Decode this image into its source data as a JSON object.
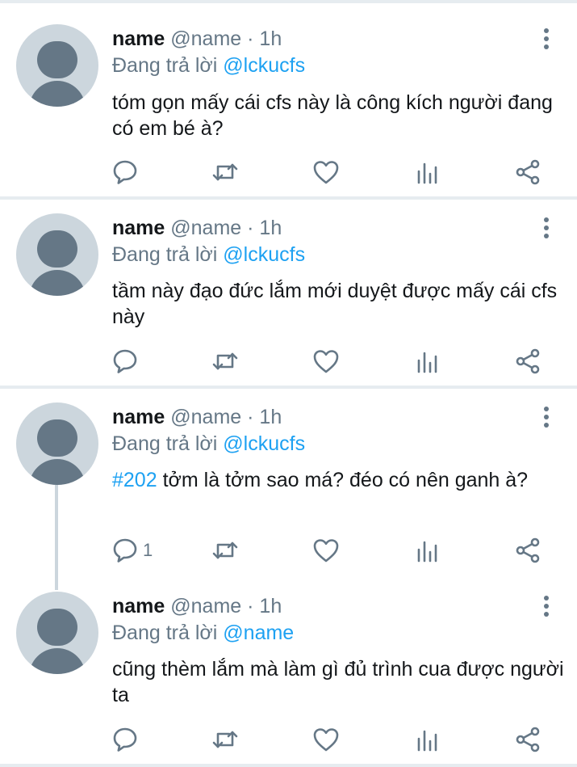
{
  "tweets": [
    {
      "name": "name",
      "handle": "@name",
      "separator": "·",
      "time": "1h",
      "reply_prefix": "Đang trả lời",
      "reply_to": "@lckucfs",
      "hashtag": "",
      "text": "tóm gọn mấy cái cfs này là công kích người đang có em bé à?",
      "reply_count": "",
      "icons": [
        "reply-icon",
        "retweet-icon",
        "like-icon",
        "stats-icon",
        "share-icon"
      ]
    },
    {
      "name": "name",
      "handle": "@name",
      "separator": "·",
      "time": "1h",
      "reply_prefix": "Đang trả lời",
      "reply_to": "@lckucfs",
      "hashtag": "",
      "text": "tầm này đạo đức lắm mới duyệt được mấy cái cfs này",
      "reply_count": "",
      "icons": [
        "reply-icon",
        "retweet-icon",
        "like-icon",
        "stats-icon",
        "share-icon"
      ]
    },
    {
      "name": "name",
      "handle": "@name",
      "separator": "·",
      "time": "1h",
      "reply_prefix": "Đang trả lời",
      "reply_to": "@lckucfs",
      "hashtag": "#202",
      "text": " tởm là tởm sao má? đéo có nên ganh à?",
      "reply_count": "1",
      "icons": [
        "reply-icon",
        "retweet-icon",
        "like-icon",
        "stats-icon",
        "share-icon"
      ]
    },
    {
      "name": "name",
      "handle": "@name",
      "separator": "·",
      "time": "1h",
      "reply_prefix": "Đang trả lời",
      "reply_to": "@name",
      "hashtag": "",
      "text": "cũng thèm lắm mà làm gì đủ trình cua được người ta",
      "reply_count": "",
      "icons": [
        "reply-icon",
        "retweet-icon",
        "like-icon",
        "stats-icon",
        "share-icon"
      ]
    }
  ],
  "colors": {
    "link": "#1da1f2",
    "secondary": "#657786",
    "avatar_bg": "#ccd6dd",
    "divider": "#e6ecf0"
  }
}
